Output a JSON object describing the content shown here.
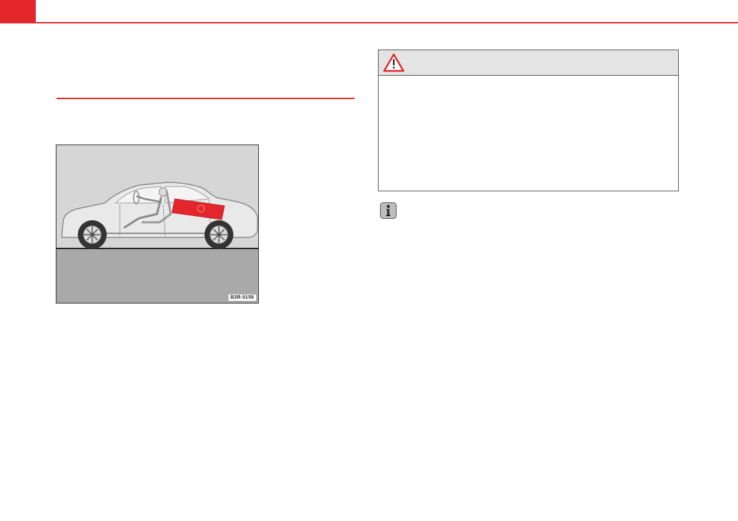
{
  "header": {
    "accent_color": "#e3262b"
  },
  "figure": {
    "label": "B3R-0156",
    "highlight_color": "#e3262b",
    "description_icon": "car-side-airbag-illustration"
  },
  "warning": {
    "icon": "warning-triangle-icon"
  },
  "note": {
    "icon": "info-icon"
  }
}
